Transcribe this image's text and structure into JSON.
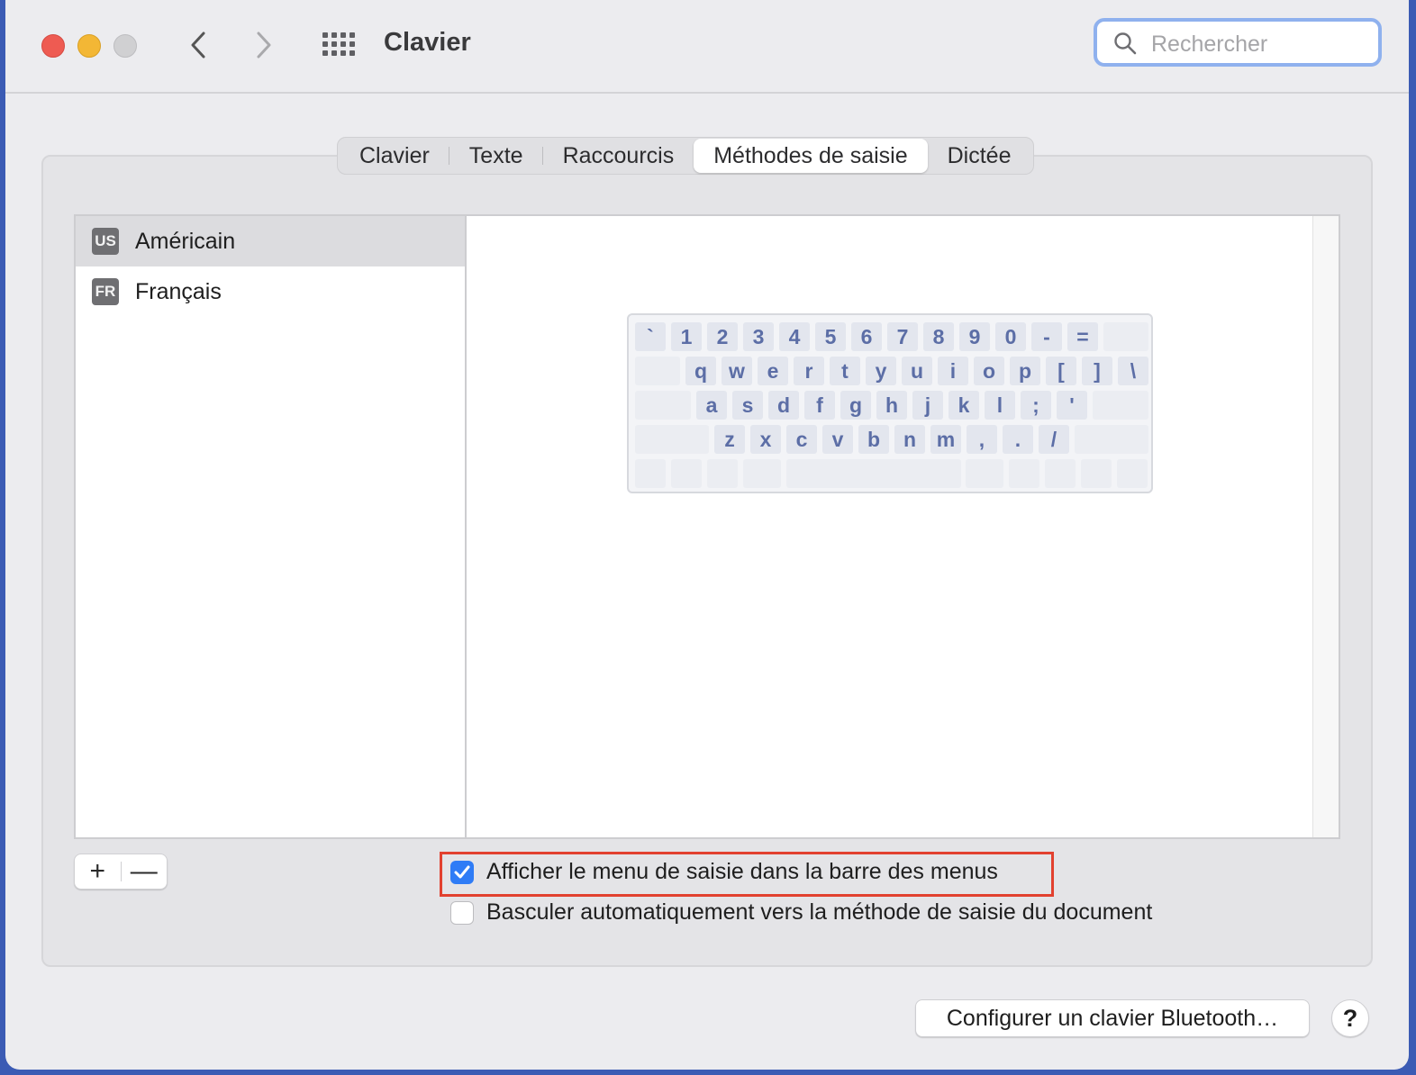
{
  "window": {
    "title": "Clavier",
    "search_placeholder": "Rechercher"
  },
  "tabs": [
    {
      "label": "Clavier",
      "active": false
    },
    {
      "label": "Texte",
      "active": false
    },
    {
      "label": "Raccourcis",
      "active": false
    },
    {
      "label": "Méthodes de saisie",
      "active": true
    },
    {
      "label": "Dictée",
      "active": false
    }
  ],
  "input_sources": [
    {
      "badge": "US",
      "name": "Américain",
      "selected": true
    },
    {
      "badge": "FR",
      "name": "Français",
      "selected": false
    }
  ],
  "keyboard": {
    "row1": [
      "`",
      "1",
      "2",
      "3",
      "4",
      "5",
      "6",
      "7",
      "8",
      "9",
      "0",
      "-",
      "="
    ],
    "row2": [
      "q",
      "w",
      "e",
      "r",
      "t",
      "y",
      "u",
      "i",
      "o",
      "p",
      "[",
      "]",
      "\\"
    ],
    "row3": [
      "a",
      "s",
      "d",
      "f",
      "g",
      "h",
      "j",
      "k",
      "l",
      ";",
      "'"
    ],
    "row4": [
      "z",
      "x",
      "c",
      "v",
      "b",
      "n",
      "m",
      ",",
      ".",
      "/"
    ]
  },
  "list_controls": {
    "add": "+",
    "remove": "—"
  },
  "options": {
    "show_menu": {
      "label": "Afficher le menu de saisie dans la barre des menus",
      "checked": true
    },
    "auto_switch": {
      "label": "Basculer automatiquement vers la méthode de saisie du document",
      "checked": false
    }
  },
  "buttons": {
    "bluetooth": "Configurer un clavier Bluetooth…",
    "help": "?"
  },
  "colors": {
    "accent": "#2f7cf6",
    "highlight_border": "#e2412f",
    "key_text": "#5c6ea6"
  }
}
